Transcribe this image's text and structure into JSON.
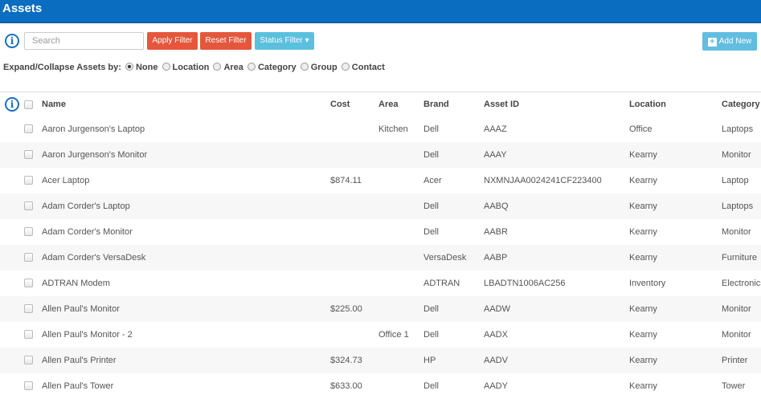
{
  "header": {
    "title": "Assets"
  },
  "toolbar": {
    "search_placeholder": "Search",
    "apply_label": "Apply Filter",
    "reset_label": "Reset Filter",
    "status_label": "Status Filter",
    "add_label": "Add New"
  },
  "expand": {
    "label": "Expand/Collapse Assets by:",
    "options": [
      "None",
      "Location",
      "Area",
      "Category",
      "Group",
      "Contact"
    ],
    "selected": "None"
  },
  "table": {
    "columns": [
      "Name",
      "Cost",
      "Area",
      "Brand",
      "Asset ID",
      "Location",
      "Category"
    ],
    "rows": [
      [
        "Aaron Jurgenson's Laptop",
        "",
        "Kitchen",
        "Dell",
        "AAAZ",
        "Office",
        "Laptops"
      ],
      [
        "Aaron Jurgenson's Monitor",
        "",
        "",
        "Dell",
        "AAAY",
        "Kearny",
        "Monitor"
      ],
      [
        "Acer Laptop",
        "$874.11",
        "",
        "Acer",
        "NXMNJAA0024241CF223400",
        "Kearny",
        "Laptop"
      ],
      [
        "Adam Corder's Laptop",
        "",
        "",
        "Dell",
        "AABQ",
        "Kearny",
        "Laptops"
      ],
      [
        "Adam Corder's Monitor",
        "",
        "",
        "Dell",
        "AABR",
        "Kearny",
        "Monitor"
      ],
      [
        "Adam Corder's VersaDesk",
        "",
        "",
        "VersaDesk",
        "AABP",
        "Kearny",
        "Furniture"
      ],
      [
        "ADTRAN Modem",
        "",
        "",
        "ADTRAN",
        "LBADTN1006AC256",
        "Inventory",
        "Electronics"
      ],
      [
        "Allen Paul's Monitor",
        "$225.00",
        "",
        "Dell",
        "AADW",
        "Kearny",
        "Monitor"
      ],
      [
        "Allen Paul's Monitor - 2",
        "",
        "Office 1",
        "Dell",
        "AADX",
        "Kearny",
        "Monitor"
      ],
      [
        "Allen Paul's Printer",
        "$324.73",
        "",
        "HP",
        "AADV",
        "Kearny",
        "Printer"
      ],
      [
        "Allen Paul's Tower",
        "$633.00",
        "",
        "Dell",
        "AADY",
        "Kearny",
        "Tower"
      ]
    ]
  },
  "colors": {
    "header_bg": "#0b6dc0",
    "apply": "#e4573d",
    "status": "#5bc0de",
    "add": "#62bde0"
  }
}
